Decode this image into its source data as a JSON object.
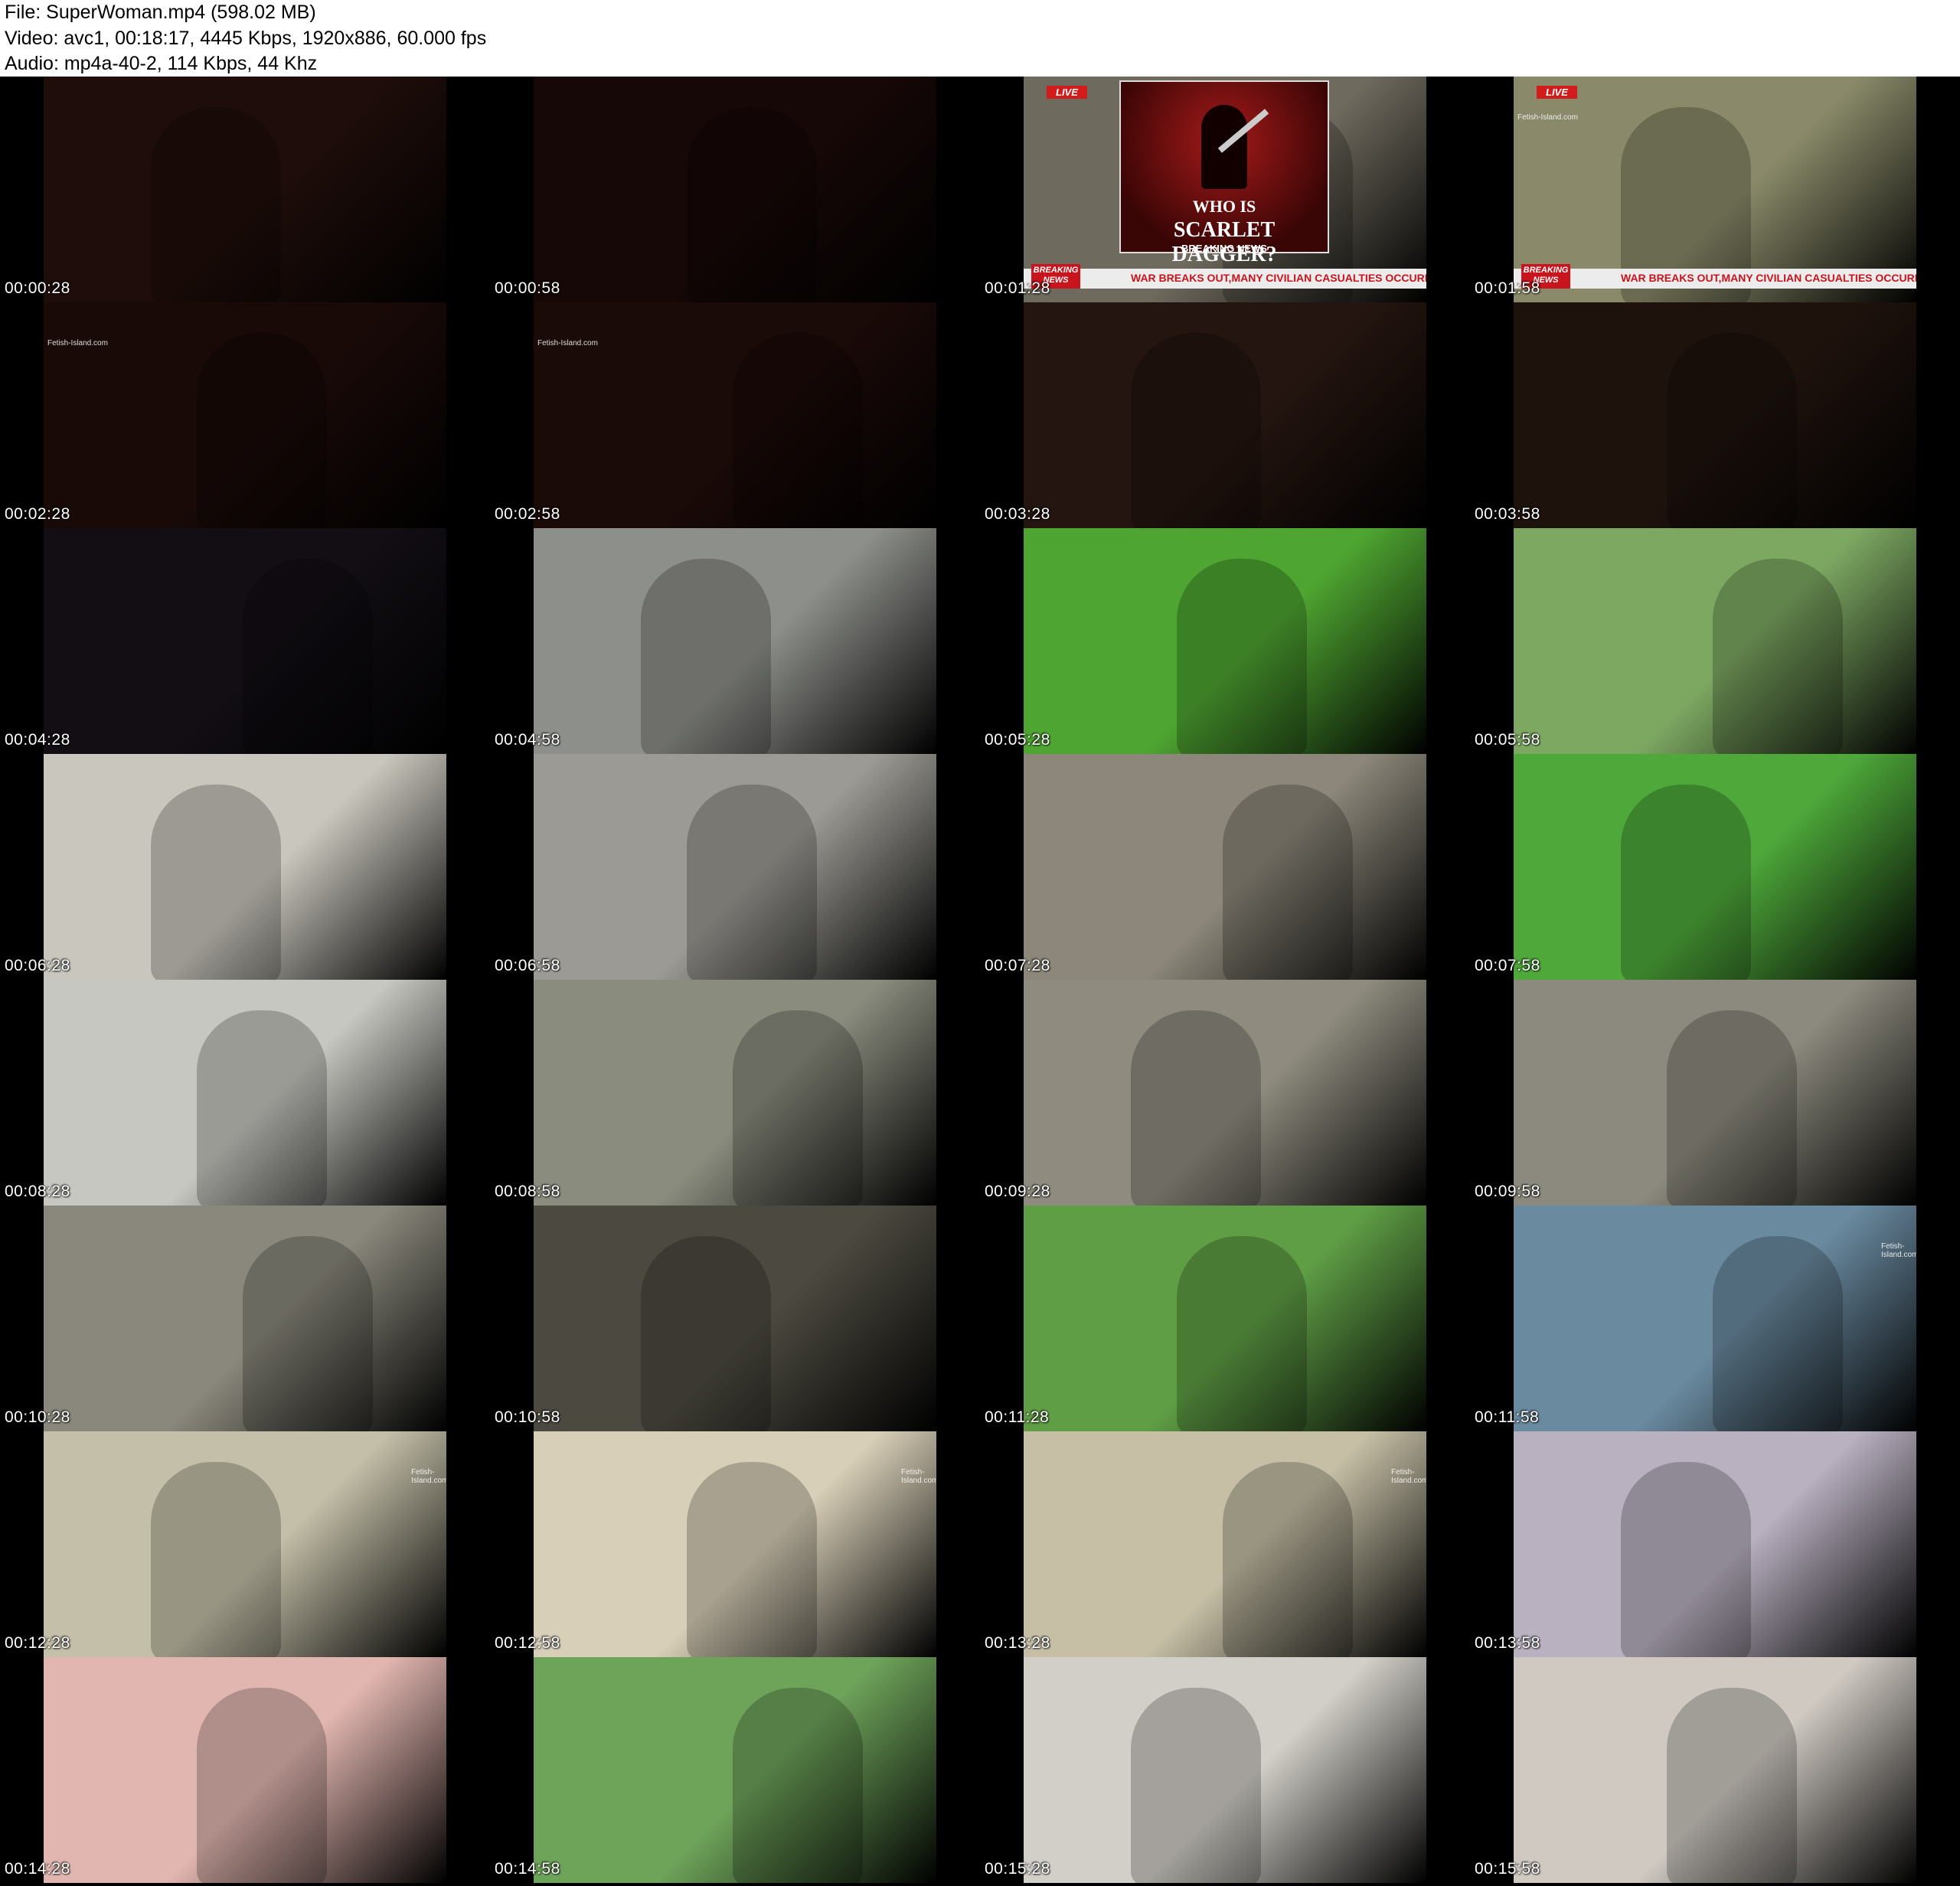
{
  "header": {
    "file_line": "File: SuperWoman.mp4 (598.02 MB)",
    "video_line": "Video: avc1, 00:18:17, 4445 Kbps, 1920x886, 60.000 fps",
    "audio_line": "Audio: mp4a-40-2, 114 Kbps, 44 Khz"
  },
  "watermark": "Fetish-Island.com",
  "news": {
    "live": "LIVE",
    "breaking_badge": "BREAKING NEWS",
    "ticker": "WAR BREAKS OUT,MANY CIVILIAN CASUALTIES OCCURRED",
    "who_is": "WHO IS",
    "scarlet": "SCARLET DAGGER?",
    "breaking_news": "BREAKING NEWS"
  },
  "thumbnails": [
    {
      "time": "00:00:28",
      "bg": "#1e0d0a"
    },
    {
      "time": "00:00:58",
      "bg": "#160807"
    },
    {
      "time": "00:01:28",
      "bg": "#6f6a5e"
    },
    {
      "time": "00:01:58",
      "bg": "#8a8a6a"
    },
    {
      "time": "00:02:28",
      "bg": "#190a08"
    },
    {
      "time": "00:02:58",
      "bg": "#1a0a08"
    },
    {
      "time": "00:03:28",
      "bg": "#241510"
    },
    {
      "time": "00:03:58",
      "bg": "#1e120d"
    },
    {
      "time": "00:04:28",
      "bg": "#120e14"
    },
    {
      "time": "00:04:58",
      "bg": "#8d8f8a"
    },
    {
      "time": "00:05:28",
      "bg": "#4ea531"
    },
    {
      "time": "00:05:58",
      "bg": "#7da862"
    },
    {
      "time": "00:06:28",
      "bg": "#c9c6bd"
    },
    {
      "time": "00:06:58",
      "bg": "#9b9a94"
    },
    {
      "time": "00:07:28",
      "bg": "#8c877a"
    },
    {
      "time": "00:07:58",
      "bg": "#4ea83a"
    },
    {
      "time": "00:08:28",
      "bg": "#c7c7c1"
    },
    {
      "time": "00:08:58",
      "bg": "#8a8c7e"
    },
    {
      "time": "00:09:28",
      "bg": "#8f8c7f"
    },
    {
      "time": "00:09:58",
      "bg": "#8c8a7e"
    },
    {
      "time": "00:10:28",
      "bg": "#8a887c"
    },
    {
      "time": "00:10:58",
      "bg": "#4c4a40"
    },
    {
      "time": "00:11:28",
      "bg": "#5f9e45"
    },
    {
      "time": "00:11:58",
      "bg": "#6a8aa0"
    },
    {
      "time": "00:12:28",
      "bg": "#c4bfa8"
    },
    {
      "time": "00:12:58",
      "bg": "#d8cfb8"
    },
    {
      "time": "00:13:28",
      "bg": "#c6bfa6"
    },
    {
      "time": "00:13:58",
      "bg": "#b9b0c0"
    },
    {
      "time": "00:14:28",
      "bg": "#e2b6b0"
    },
    {
      "time": "00:14:58",
      "bg": "#6ea35a"
    },
    {
      "time": "00:15:28",
      "bg": "#d2cfc8"
    },
    {
      "time": "00:15:58",
      "bg": "#cfc9c2"
    }
  ]
}
